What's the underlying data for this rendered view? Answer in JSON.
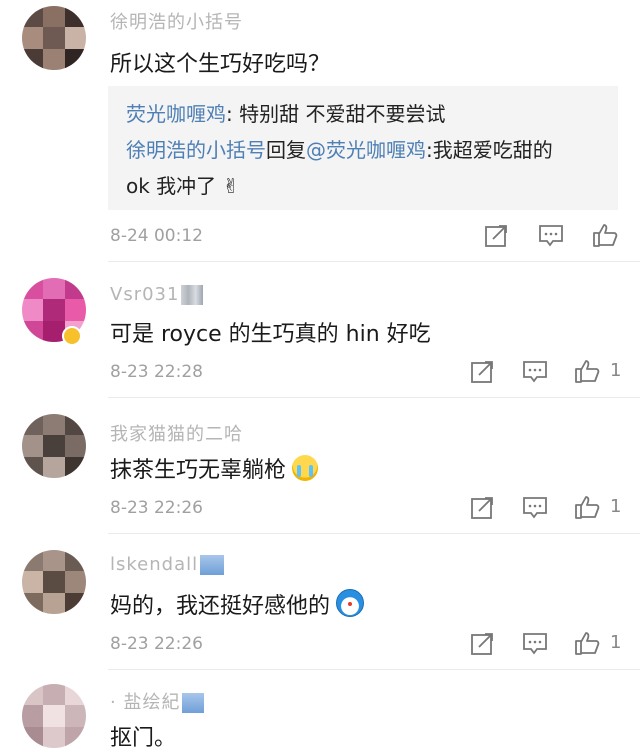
{
  "comments": [
    {
      "username": "徐明浩的小括号",
      "content": "所以这个生巧好吃吗？",
      "time": "8-24 00:12",
      "likes": "",
      "avatar_colors": [
        "#5c4a45",
        "#8a6f63",
        "#3d302c",
        "#a88c7e",
        "#6e5a52",
        "#c9b2a6",
        "#4a3b36",
        "#9b8074",
        "#2f2522"
      ],
      "replies": [
        {
          "name": "荧光咖喱鸡",
          "text": ": 特别甜 不爱甜不要尝试"
        },
        {
          "name": "徐明浩的小括号",
          "middle": "回复",
          "mention": "@荧光咖喱鸡",
          "text": ":我超爱吃甜的",
          "text2": "ok 我冲了 ✌"
        }
      ]
    },
    {
      "username": "Vsr031",
      "content": "可是 royce 的生巧真的 hin 好吃",
      "time": "8-23 22:28",
      "likes": "1",
      "avatar_colors": [
        "#d94fa0",
        "#e36db4",
        "#c23a8c",
        "#f08ac6",
        "#b02a7a",
        "#e95aa9",
        "#cf4796",
        "#a61f6e",
        "#f2a1cf"
      ]
    },
    {
      "username": "我家猫猫的二哈",
      "content": "抹茶生巧无辜躺枪",
      "emoji": "crying-face-icon",
      "time": "8-23 22:26",
      "likes": "1",
      "avatar_colors": [
        "#6f625c",
        "#8d7c74",
        "#524742",
        "#a39289",
        "#4a403b",
        "#7a6b64",
        "#5f534d",
        "#b5a59c",
        "#3e3531"
      ]
    },
    {
      "username": "lskendall",
      "content": "妈的，我还挺好感他的",
      "emoji": "doraemon-icon",
      "time": "8-23 22:26",
      "likes": "1",
      "avatar_colors": [
        "#8b7a70",
        "#a89488",
        "#6b5c53",
        "#c9b4a6",
        "#5a4b43",
        "#9c877a",
        "#7d6b60",
        "#b8a293",
        "#4b3d36"
      ]
    },
    {
      "username": "· 盐绘紀",
      "content": "抠门。",
      "time": "",
      "likes": "",
      "avatar_colors": [
        "#d9c4c6",
        "#c7aeb2",
        "#e8d6d8",
        "#b89da2",
        "#f0e2e3",
        "#cdb6ba",
        "#a88c91",
        "#ddc8cb",
        "#bfa5aa"
      ]
    }
  ],
  "colors": {
    "link": "#4e7fb5",
    "meta": "#a0a0a0",
    "divider": "#ebebeb",
    "reply_bg": "#f4f4f4"
  },
  "icons": {
    "share": "share-icon",
    "comment": "comment-icon",
    "like": "thumbs-up-icon"
  }
}
